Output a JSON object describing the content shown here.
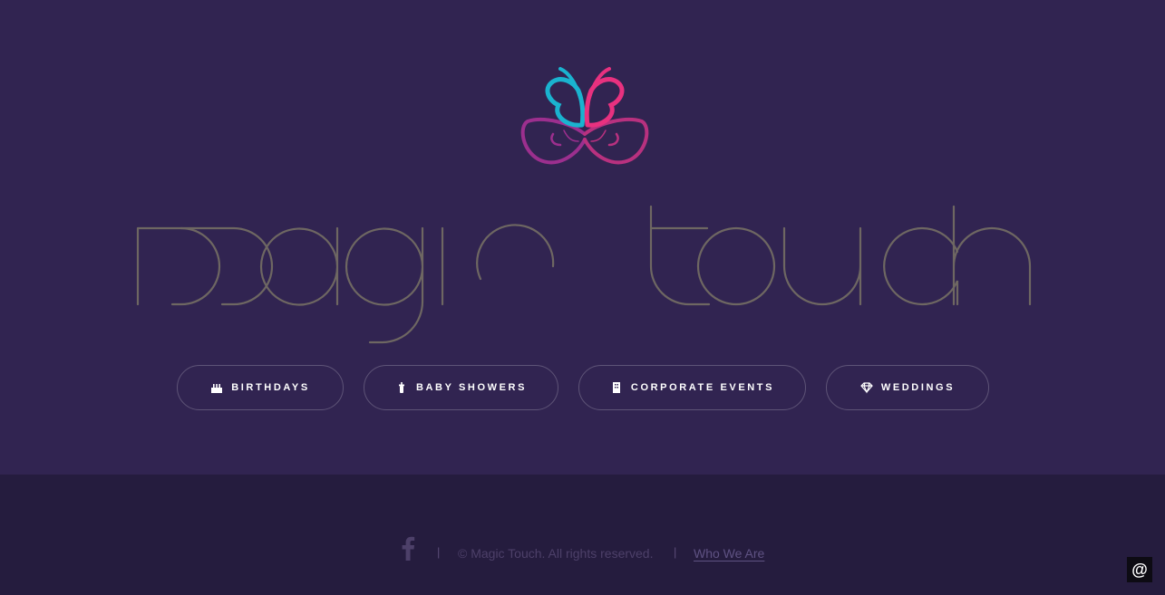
{
  "brand": {
    "name": "Magic Touch",
    "logo_icon": "butterfly-logo-icon",
    "colors": {
      "cyan": "#1ab3cf",
      "pink": "#e8317f",
      "magenta": "#9c2f8e",
      "wordmark": "#6e6762"
    }
  },
  "nav": {
    "items": [
      {
        "label": "BIRTHDAYS",
        "icon": "cake-icon"
      },
      {
        "label": "BABY SHOWERS",
        "icon": "baby-bottle-icon"
      },
      {
        "label": "CORPORATE EVENTS",
        "icon": "building-icon"
      },
      {
        "label": "WEDDINGS",
        "icon": "diamond-icon"
      }
    ]
  },
  "footer": {
    "social_icon": "facebook-icon",
    "separator": "|",
    "copyright": "© Magic Touch. All rights reserved.",
    "link_label": "Who We Are",
    "floating_button": "@"
  },
  "colors": {
    "hero_bg": "#312451",
    "footer_bg": "#251c3e"
  }
}
